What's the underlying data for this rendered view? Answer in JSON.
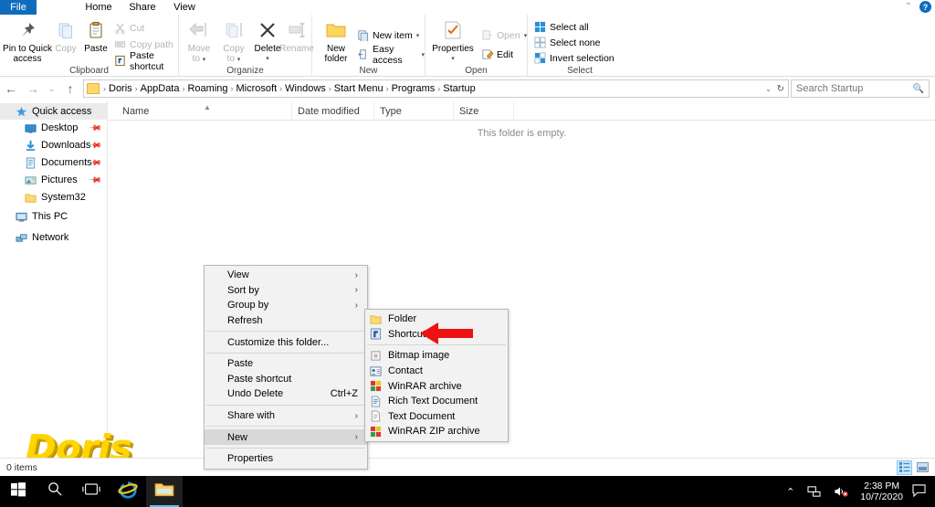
{
  "window": {
    "tabs": [
      {
        "label": "File",
        "active": true
      },
      {
        "label": "Home",
        "active": false
      },
      {
        "label": "Share",
        "active": false
      },
      {
        "label": "View",
        "active": false
      }
    ],
    "help_glyph": "?",
    "minimize_ribbon_glyph": "⌃"
  },
  "ribbon": {
    "groups": [
      {
        "name": "Clipboard",
        "label": "Clipboard",
        "big_buttons": [
          {
            "label": "Pin to Quick\naccess",
            "line1": "Pin to Quick",
            "line2": "access",
            "icon": "pin-icon",
            "disabled": false
          },
          {
            "label": "Copy",
            "line1": "Copy",
            "line2": "",
            "icon": "copy-icon",
            "disabled": true
          },
          {
            "label": "Paste",
            "line1": "Paste",
            "line2": "",
            "icon": "paste-icon",
            "disabled": false
          }
        ],
        "small_buttons": [
          {
            "label": "Cut",
            "icon": "scissors-icon",
            "disabled": true
          },
          {
            "label": "Copy path",
            "icon": "copy-path-icon",
            "disabled": true
          },
          {
            "label": "Paste shortcut",
            "icon": "paste-shortcut-icon",
            "disabled": false
          }
        ]
      },
      {
        "name": "Organize",
        "label": "Organize",
        "big_buttons": [
          {
            "line1": "Move",
            "line2": "to",
            "icon": "move-to-icon",
            "disabled": true,
            "caret": true
          },
          {
            "line1": "Copy",
            "line2": "to",
            "icon": "copy-to-icon",
            "disabled": true,
            "caret": true
          },
          {
            "line1": "Delete",
            "line2": "",
            "icon": "delete-x-icon",
            "disabled": false,
            "caret": true
          },
          {
            "line1": "Rename",
            "line2": "",
            "icon": "rename-icon",
            "disabled": true,
            "caret": false
          }
        ]
      },
      {
        "name": "New",
        "label": "New",
        "big_buttons": [
          {
            "line1": "New",
            "line2": "folder",
            "icon": "new-folder-icon",
            "disabled": false
          }
        ],
        "small_buttons": [
          {
            "label": "New item",
            "icon": "new-item-icon",
            "disabled": false,
            "caret": true
          },
          {
            "label": "Easy access",
            "icon": "easy-access-icon",
            "disabled": false,
            "caret": true
          }
        ]
      },
      {
        "name": "Open",
        "label": "Open",
        "big_buttons": [
          {
            "line1": "Properties",
            "line2": "",
            "icon": "properties-icon",
            "disabled": false,
            "caret": true
          }
        ],
        "small_buttons": [
          {
            "label": "Open",
            "icon": "open-icon",
            "disabled": true,
            "caret": true
          },
          {
            "label": "Edit",
            "icon": "edit-icon",
            "disabled": false
          }
        ]
      },
      {
        "name": "Select",
        "label": "Select",
        "small_buttons": [
          {
            "label": "Select all",
            "icon": "select-all-icon",
            "disabled": false
          },
          {
            "label": "Select none",
            "icon": "select-none-icon",
            "disabled": false
          },
          {
            "label": "Invert selection",
            "icon": "invert-selection-icon",
            "disabled": false
          }
        ]
      }
    ]
  },
  "address_bar": {
    "back_glyph": "←",
    "forward_glyph": "→",
    "recent_glyph": "⌄",
    "up_glyph": "↑",
    "breadcrumbs": [
      "Doris",
      "AppData",
      "Roaming",
      "Microsoft",
      "Windows",
      "Start Menu",
      "Programs",
      "Startup"
    ],
    "separator": "›",
    "dropdown_glyph": "⌄",
    "refresh_glyph": "↻"
  },
  "search": {
    "placeholder": "Search Startup",
    "value": "",
    "icon": "search-icon"
  },
  "columns": [
    {
      "label": "Name",
      "sorted": true
    },
    {
      "label": "Date modified",
      "sorted": false
    },
    {
      "label": "Type",
      "sorted": false
    },
    {
      "label": "Size",
      "sorted": false
    }
  ],
  "nav_pane": {
    "items": [
      {
        "label": "Quick access",
        "icon": "star-pin-icon",
        "indent": 0,
        "selected": true,
        "pinned": false
      },
      {
        "label": "Desktop",
        "icon": "desktop-icon",
        "indent": 1,
        "selected": false,
        "pinned": true
      },
      {
        "label": "Downloads",
        "icon": "downloads-icon",
        "indent": 1,
        "selected": false,
        "pinned": true
      },
      {
        "label": "Documents",
        "icon": "documents-icon",
        "indent": 1,
        "selected": false,
        "pinned": true
      },
      {
        "label": "Pictures",
        "icon": "pictures-icon",
        "indent": 1,
        "selected": false,
        "pinned": true
      },
      {
        "label": "System32",
        "icon": "folder-icon",
        "indent": 1,
        "selected": false,
        "pinned": false
      },
      {
        "label": "This PC",
        "icon": "this-pc-icon",
        "indent": 0,
        "selected": false,
        "pinned": false
      },
      {
        "label": "Network",
        "icon": "network-icon",
        "indent": 0,
        "selected": false,
        "pinned": false
      }
    ]
  },
  "file_list": {
    "empty_message": "This folder is empty."
  },
  "context_menu": {
    "items": [
      {
        "label": "View",
        "submenu": true,
        "accel": "",
        "highlight": false,
        "sep_after": false
      },
      {
        "label": "Sort by",
        "submenu": true,
        "accel": "",
        "highlight": false,
        "sep_after": false
      },
      {
        "label": "Group by",
        "submenu": true,
        "accel": "",
        "highlight": false,
        "sep_after": false
      },
      {
        "label": "Refresh",
        "submenu": false,
        "accel": "",
        "highlight": false,
        "sep_after": true
      },
      {
        "label": "Customize this folder...",
        "submenu": false,
        "accel": "",
        "highlight": false,
        "sep_after": true
      },
      {
        "label": "Paste",
        "submenu": false,
        "accel": "",
        "highlight": false,
        "sep_after": false
      },
      {
        "label": "Paste shortcut",
        "submenu": false,
        "accel": "",
        "highlight": false,
        "sep_after": false
      },
      {
        "label": "Undo Delete",
        "submenu": false,
        "accel": "Ctrl+Z",
        "highlight": false,
        "sep_after": true
      },
      {
        "label": "Share with",
        "submenu": true,
        "accel": "",
        "highlight": false,
        "sep_after": true
      },
      {
        "label": "New",
        "submenu": true,
        "accel": "",
        "highlight": true,
        "sep_after": true
      },
      {
        "label": "Properties",
        "submenu": false,
        "accel": "",
        "highlight": false,
        "sep_after": false
      }
    ],
    "submenu_arrow": "›"
  },
  "new_submenu": {
    "items": [
      {
        "label": "Folder",
        "icon": "folder-icon",
        "sep_after": false
      },
      {
        "label": "Shortcut",
        "icon": "shortcut-icon",
        "sep_after": true
      },
      {
        "label": "Bitmap image",
        "icon": "bitmap-icon",
        "sep_after": false
      },
      {
        "label": "Contact",
        "icon": "contact-icon",
        "sep_after": false
      },
      {
        "label": "WinRAR archive",
        "icon": "winrar-icon",
        "sep_after": false
      },
      {
        "label": "Rich Text Document",
        "icon": "rtf-icon",
        "sep_after": false
      },
      {
        "label": "Text Document",
        "icon": "text-doc-icon",
        "sep_after": false
      },
      {
        "label": "WinRAR ZIP archive",
        "icon": "winrar-zip-icon",
        "sep_after": false
      }
    ]
  },
  "annotation": {
    "arrow": "red-left-arrow",
    "color": "#ee1111",
    "points_at": "Shortcut"
  },
  "watermark": {
    "text": "Doris",
    "color": "#ffd400"
  },
  "status_bar": {
    "items_text": "0 items",
    "views": [
      {
        "name": "details-view",
        "active": true
      },
      {
        "name": "large-icons-view",
        "active": false
      }
    ]
  },
  "taskbar": {
    "buttons": [
      {
        "name": "start-button",
        "icon": "windows-logo-icon",
        "active": false
      },
      {
        "name": "search-button",
        "icon": "search-icon",
        "active": false
      },
      {
        "name": "task-view-button",
        "icon": "task-view-icon",
        "active": false
      },
      {
        "name": "internet-explorer-button",
        "icon": "internet-explorer-icon",
        "active": false
      },
      {
        "name": "file-explorer-button",
        "icon": "folder-icon",
        "active": true
      }
    ],
    "tray": {
      "chevron": "⌃",
      "network_icon": "network-tray-icon",
      "volume_icon": "volume-muted-icon",
      "time": "2:38 PM",
      "date": "10/7/2020",
      "action_center_icon": "action-center-icon"
    }
  }
}
